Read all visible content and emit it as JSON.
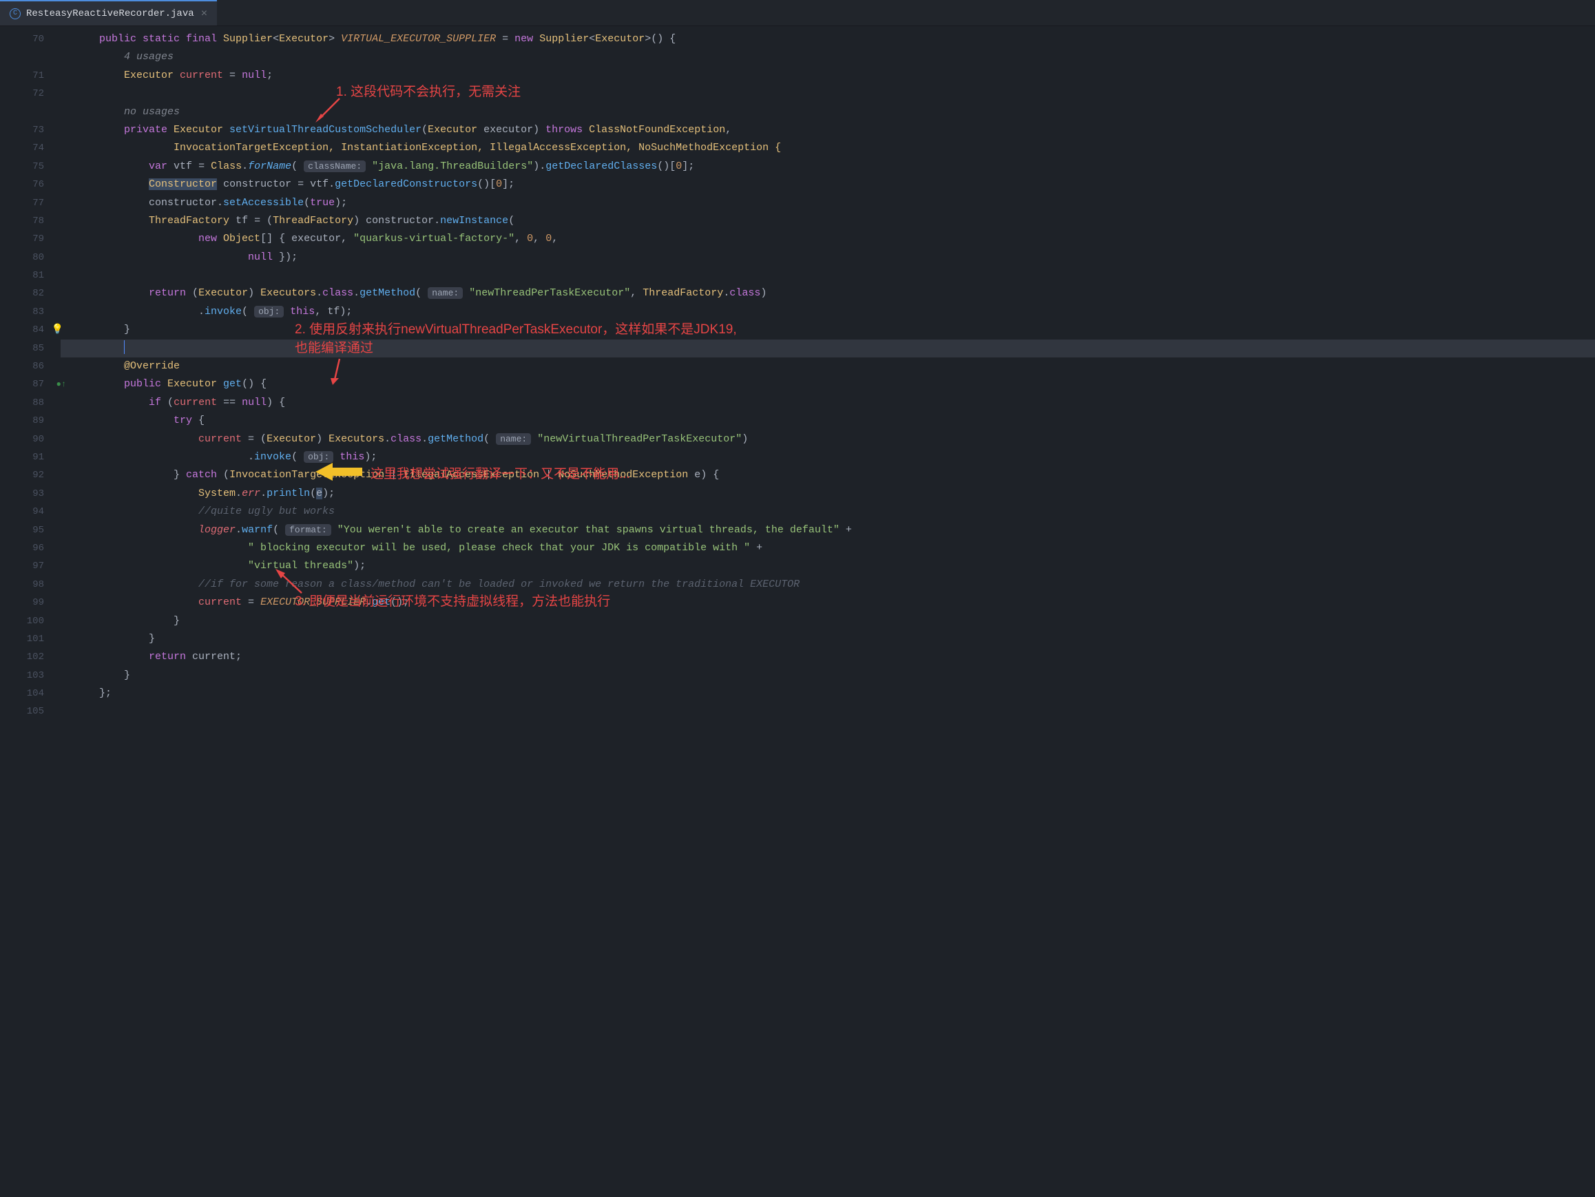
{
  "tab": {
    "filename": "ResteasyReactiveRecorder.java"
  },
  "hints": {
    "usages4": "4 usages",
    "noUsages": "no usages",
    "className": "className:",
    "name": "name:",
    "obj": "obj:",
    "format": "format:"
  },
  "annotations": {
    "a1": "1. 这段代码不会执行，无需关注",
    "a2_l1": "2. 使用反射来执行newVirtualThreadPerTaskExecutor，这样如果不是JDK19,",
    "a2_l2": "也能编译通过",
    "a3": "这里我想尝试强行翻译一下：又不是不能用...",
    "a4": "3. 即便是当前运行环境不支持虚拟线程，方法也能执行"
  },
  "gutter": [
    "70",
    "",
    "71",
    "72",
    "",
    "73",
    "74",
    "75",
    "76",
    "77",
    "78",
    "79",
    "80",
    "81",
    "82",
    "83",
    "84",
    "85",
    "86",
    "87",
    "88",
    "89",
    "90",
    "91",
    "92",
    "93",
    "94",
    "95",
    "96",
    "97",
    "98",
    "99",
    "100",
    "101",
    "102",
    "103",
    "104",
    "105"
  ],
  "code": {
    "l70_pre": "    ",
    "l70_kw1": "public static final ",
    "l70_t1": "Supplier",
    "l70_a1": "<",
    "l70_t2": "Executor",
    "l70_a2": "> ",
    "l70_const": "VIRTUAL_EXECUTOR_SUPPLIER",
    "l70_eq": " = ",
    "l70_new": "new ",
    "l70_t3": "Supplier",
    "l70_a3": "<",
    "l70_t4": "Executor",
    "l70_a4": ">() {",
    "l71_pre": "        ",
    "l71_t": "Executor ",
    "l71_v": "current",
    "l71_rest": " = ",
    "l71_null": "null",
    "l71_sc": ";",
    "l72": "",
    "l73_pre": "        ",
    "l73_kw": "private ",
    "l73_t": "Executor ",
    "l73_fn": "setVirtualThreadCustomScheduler",
    "l73_p1": "(",
    "l73_t2": "Executor ",
    "l73_v2": "executor",
    "l73_p2": ") ",
    "l73_throws": "throws ",
    "l73_ex": "ClassNotFoundException",
    "l73_c": ",",
    "l74_pre": "                ",
    "l74_rest": "InvocationTargetException, InstantiationException, IllegalAccessException, NoSuchMethodException {",
    "l75_pre": "            ",
    "l75_var": "var ",
    "l75_v": "vtf ",
    "l75_eq": "= ",
    "l75_cls": "Class",
    "l75_d": ".",
    "l75_fn": "forName",
    "l75_p1": "( ",
    "l75_s": "\"java.lang.ThreadBuilders\"",
    "l75_p2": ").",
    "l75_fn2": "getDeclaredClasses",
    "l75_rest": "()[",
    "l75_n": "0",
    "l75_end": "];",
    "l76_pre": "            ",
    "l76_sel": "Constructor",
    "l76_rest": " constructor = vtf.",
    "l76_fn": "getDeclaredConstructors",
    "l76_p": "()[",
    "l76_n": "0",
    "l76_end": "];",
    "l77_pre": "            constructor.",
    "l77_fn": "setAccessible",
    "l77_p": "(",
    "l77_true": "true",
    "l77_end": ");",
    "l78_pre": "            ",
    "l78_t": "ThreadFactory ",
    "l78_v": "tf ",
    "l78_eq": "= (",
    "l78_t2": "ThreadFactory",
    "l78_p": ") constructor.",
    "l78_fn": "newInstance",
    "l78_end": "(",
    "l79_pre": "                    ",
    "l79_new": "new ",
    "l79_t": "Object",
    "l79_arr": "[] { executor, ",
    "l79_s": "\"quarkus-virtual-factory-\"",
    "l79_c": ", ",
    "l79_n1": "0",
    "l79_c2": ", ",
    "l79_n2": "0",
    "l79_end": ",",
    "l80_pre": "                            ",
    "l80_null": "null ",
    "l80_end": "});",
    "l81": "",
    "l82_pre": "            ",
    "l82_ret": "return ",
    "l82_p1": "(",
    "l82_t": "Executor",
    "l82_p2": ") ",
    "l82_cls": "Executors",
    "l82_d": ".",
    "l82_kw": "class",
    "l82_d2": ".",
    "l82_fn": "getMethod",
    "l82_p3": "( ",
    "l82_s": "\"newThreadPerTaskExecutor\"",
    "l82_c": ", ",
    "l82_t2": "ThreadFactory",
    "l82_d3": ".",
    "l82_kw2": "class",
    "l82_end": ")",
    "l83_pre": "                    .",
    "l83_fn": "invoke",
    "l83_p": "( ",
    "l83_this": "this",
    "l83_c": ", tf);",
    "l84_pre": "        }",
    "l85_pre": "        ",
    "l86_pre": "        ",
    "l86_ann": "@Override",
    "l87_pre": "        ",
    "l87_kw": "public ",
    "l87_t": "Executor ",
    "l87_fn": "get",
    "l87_end": "() {",
    "l88_pre": "            ",
    "l88_if": "if ",
    "l88_p": "(",
    "l88_v": "current ",
    "l88_eq": "== ",
    "l88_null": "null",
    "l88_end": ") {",
    "l89_pre": "                ",
    "l89_try": "try ",
    "l89_end": "{",
    "l90_pre": "                    ",
    "l90_v": "current ",
    "l90_eq": "= (",
    "l90_t": "Executor",
    "l90_p": ") ",
    "l90_cls": "Executors",
    "l90_d": ".",
    "l90_kw": "class",
    "l90_d2": ".",
    "l90_fn": "getMethod",
    "l90_p2": "( ",
    "l90_s": "\"newVirtualThreadPerTaskExecutor\"",
    "l90_end": ")",
    "l91_pre": "                            .",
    "l91_fn": "invoke",
    "l91_p": "( ",
    "l91_this": "this",
    "l91_end": ");",
    "l92_pre": "                } ",
    "l92_catch": "catch ",
    "l92_p": "(",
    "l92_t1": "InvocationTargetException ",
    "l92_b1": "| ",
    "l92_t2": "IllegalAccessException ",
    "l92_b2": "| ",
    "l92_t3": "NoSuchMethodException ",
    "l92_v": "e",
    "l92_end": ") {",
    "l93_pre": "                    ",
    "l93_sys": "System",
    "l93_d": ".",
    "l93_err": "err",
    "l93_d2": ".",
    "l93_fn": "println",
    "l93_p": "(",
    "l93_e": "e",
    "l93_end": ");",
    "l94_pre": "                    ",
    "l94_c": "//quite ugly but works",
    "l95_pre": "                    ",
    "l95_log": "logger",
    "l95_d": ".",
    "l95_fn": "warnf",
    "l95_p": "( ",
    "l95_s": "\"You weren't able to create an executor that spawns virtual threads, the default\"",
    "l95_plus": " +",
    "l96_pre": "                            ",
    "l96_s": "\" blocking executor will be used, please check that your JDK is compatible with \"",
    "l96_plus": " +",
    "l97_pre": "                            ",
    "l97_s": "\"virtual threads\"",
    "l97_end": ");",
    "l98_pre": "                    ",
    "l98_c": "//if for some reason a class/method can't be loaded or invoked we return the traditional EXECUTOR",
    "l99_pre": "                    ",
    "l99_v": "current ",
    "l99_eq": "= ",
    "l99_const": "EXECUTOR_SUPPLIER",
    "l99_d": ".",
    "l99_fn": "get",
    "l99_end": "();",
    "l100_pre": "                }",
    "l101_pre": "            }",
    "l102_pre": "            ",
    "l102_ret": "return ",
    "l102_v": "current;",
    "l103_pre": "        }",
    "l104_pre": "    };",
    "l105": ""
  }
}
